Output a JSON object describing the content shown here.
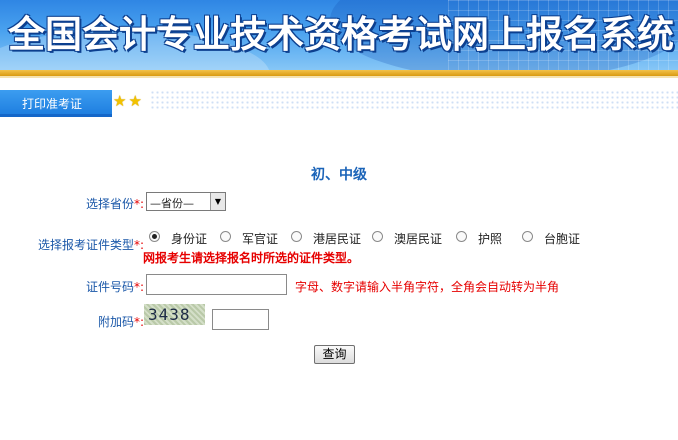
{
  "banner": {
    "title": "全国会计专业技术资格考试网上报名系统"
  },
  "tab": {
    "label": "打印准考证",
    "stars": "★★"
  },
  "form": {
    "heading": "初、中级",
    "province": {
      "label": "选择省份",
      "required": "*:",
      "selected": "—省份—"
    },
    "id_type": {
      "label": "选择报考证件类型",
      "required": "*:",
      "options": [
        {
          "label": "身份证",
          "checked": true
        },
        {
          "label": "军官证",
          "checked": false
        },
        {
          "label": "港居民证",
          "checked": false
        },
        {
          "label": "澳居民证",
          "checked": false
        },
        {
          "label": "护照",
          "checked": false
        },
        {
          "label": "台胞证",
          "checked": false
        }
      ],
      "warning": "网报考生请选择报名时所选的证件类型。"
    },
    "id_number": {
      "label": "证件号码",
      "required": "*:",
      "value": "",
      "hint": "字母、数字请输入半角字符，全角会自动转为半角"
    },
    "captcha": {
      "label": "附加码",
      "required": "*:",
      "code": "3438",
      "value": ""
    },
    "submit_label": "查询"
  }
}
